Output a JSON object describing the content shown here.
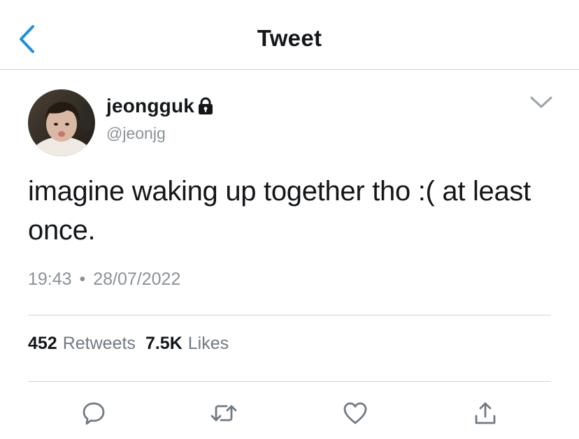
{
  "header": {
    "title": "Tweet",
    "back_icon": "chevron-left-icon"
  },
  "tweet": {
    "author": {
      "display_name": "jeongguk",
      "handle": "@jeonjg",
      "protected_icon": "lock-icon"
    },
    "text": "imagine waking up together tho :( at least once.",
    "time": "19:43",
    "separator": "•",
    "date": "28/07/2022",
    "stats": {
      "retweets_count": "452",
      "retweets_label": "Retweets",
      "likes_count": "7.5K",
      "likes_label": "Likes"
    }
  },
  "actions": {
    "reply_icon": "reply-icon",
    "retweet_icon": "retweet-icon",
    "like_icon": "heart-icon",
    "share_icon": "share-icon"
  },
  "colors": {
    "accent": "#1da1f2",
    "text": "#14171a",
    "secondary": "#8a9299",
    "divider": "#cfd4d8"
  }
}
